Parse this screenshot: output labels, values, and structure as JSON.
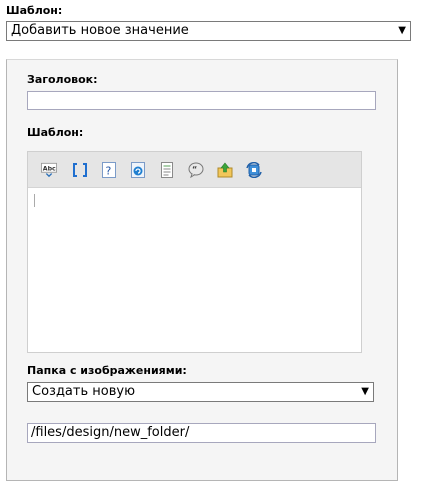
{
  "template_label": "Шаблон:",
  "template_select": {
    "value": "Добавить новое значение"
  },
  "form": {
    "title_label": "Заголовок:",
    "title_value": "",
    "template_label": "Шаблон:",
    "editor_toolbar": {
      "buttons": [
        {
          "icon": "spellcheck-icon",
          "glyph": "Abc"
        },
        {
          "icon": "brackets-icon",
          "glyph": "[ ]"
        },
        {
          "icon": "help-icon",
          "glyph": "?"
        },
        {
          "icon": "refresh-page-icon",
          "glyph": ""
        },
        {
          "icon": "document-icon",
          "glyph": ""
        },
        {
          "icon": "quote-icon",
          "glyph": ""
        },
        {
          "icon": "upload-icon",
          "glyph": ""
        },
        {
          "icon": "sync-icon",
          "glyph": ""
        }
      ]
    },
    "editor_content": "",
    "images_folder_label": "Папка с изображениями:",
    "images_folder_select": {
      "value": "Создать новую"
    },
    "folder_path_value": "/files/design/new_folder/"
  }
}
